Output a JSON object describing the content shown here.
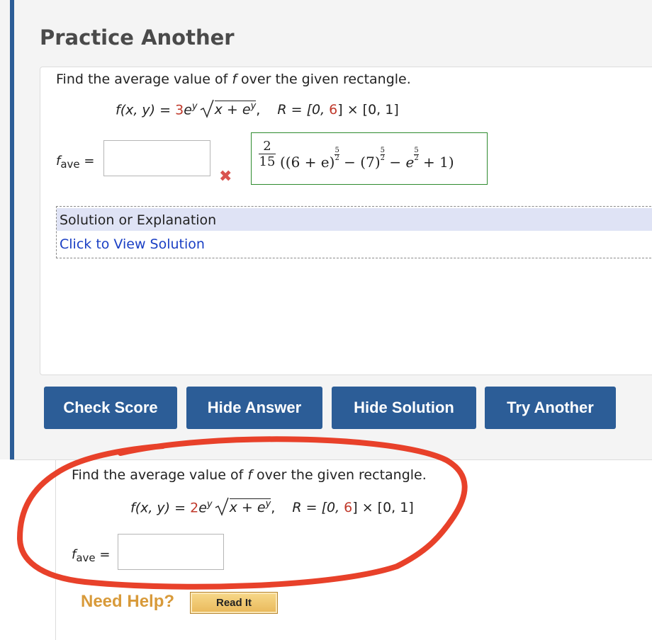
{
  "practice": {
    "title": "Practice Another",
    "question": {
      "prompt_pre": "Find the average value of ",
      "prompt_var": "f",
      "prompt_post": " over the given rectangle.",
      "f_lhs": "f(x, y) = ",
      "f_coef": "3",
      "f_rest": "e",
      "exp_y": "y",
      "sqrt_content_x": "x + e",
      "sep": ",",
      "r_label": "R = [0, ",
      "r_red": "6",
      "r_tail": "] × [0, 1]",
      "fave_f": "f",
      "fave_sub": "ave",
      "eq": "=",
      "answer_value": "",
      "incorrect_mark": "✖",
      "correct_answer": {
        "frac_num": "2",
        "frac_den": "15",
        "expr_open": "((6 + e)",
        "exp_5": "5",
        "exp_2": "2",
        "minus1": " − (7)",
        "minus2": " − e",
        "tail": " + 1)"
      }
    },
    "solution": {
      "heading": "Solution or Explanation",
      "link": "Click to View Solution"
    },
    "buttons": {
      "check_score": "Check Score",
      "hide_answer": "Hide Answer",
      "hide_solution": "Hide Solution",
      "try_another": "Try Another"
    }
  },
  "next_question": {
    "prompt_pre": "Find the average value of ",
    "prompt_var": "f",
    "prompt_post": " over the given rectangle.",
    "f_lhs": "f(x, y) = ",
    "f_coef": "2",
    "f_rest": "e",
    "exp_y": "y",
    "sqrt_content_x": "x + e",
    "sep": ",",
    "r_label": "R = [0, ",
    "r_red": "6",
    "r_tail": "] × [0, 1]",
    "fave_f": "f",
    "fave_sub": "ave",
    "eq": "=",
    "answer_value": ""
  },
  "help": {
    "label": "Need Help?",
    "read_it": "Read It"
  },
  "colors": {
    "accent": "#2c5d97",
    "annotation_red": "#e8412a",
    "correct_border": "#2e8b2e",
    "help_orange": "#d89a3a"
  }
}
